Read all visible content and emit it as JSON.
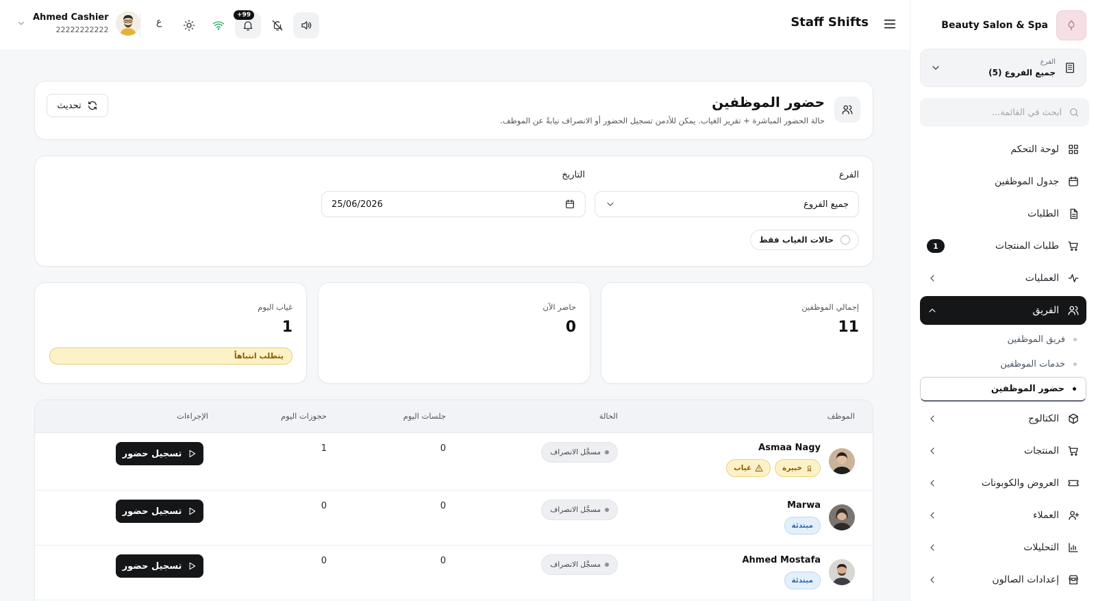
{
  "brand": {
    "name": "Beauty Salon & Spa",
    "logo_icon": "salon-logo"
  },
  "sidebar": {
    "branch": {
      "label": "الفرع",
      "value": "جميع الفروع (5)"
    },
    "search_placeholder": "ابحث في القائمة...",
    "items": [
      {
        "label": "لوحة التحكم",
        "icon": "grid-icon"
      },
      {
        "label": "جدول الموظفين",
        "icon": "calendar-icon"
      },
      {
        "label": "الطلبات",
        "icon": "document-icon"
      },
      {
        "label": "طلبات المنتجات",
        "icon": "cart-icon",
        "badge": "1"
      },
      {
        "label": "العمليات",
        "icon": "activity-icon"
      },
      {
        "label": "الفريق",
        "icon": "users-icon"
      },
      {
        "label": "الكتالوج",
        "icon": "box-icon"
      },
      {
        "label": "المنتجات",
        "icon": "cart-icon"
      },
      {
        "label": "العروض والكوبونات",
        "icon": "ticket-icon"
      },
      {
        "label": "العملاء",
        "icon": "user-plus-icon"
      },
      {
        "label": "التحليلات",
        "icon": "bar-chart-icon"
      },
      {
        "label": "إعدادات الصالون",
        "icon": "store-icon"
      }
    ],
    "team_sub": [
      {
        "label": "فريق الموظفين"
      },
      {
        "label": "خدمات الموظفين"
      },
      {
        "label": "حضور الموظفين"
      }
    ]
  },
  "header": {
    "title": "Staff Shifts",
    "notif_badge": "+99",
    "lang": "ع",
    "user": {
      "name": "Ahmed Cashier",
      "phone": "22222222222"
    }
  },
  "page": {
    "title": "حضور الموظفين",
    "subtitle": "حالة الحضور المباشرة + تقرير الغياب. يمكن للأدمن تسجيل الحضور أو الانصراف نيابةً عن الموظف.",
    "refresh_label": "تحديث"
  },
  "filters": {
    "branch_label": "الفرع",
    "branch_value": "جميع الفروع",
    "date_label": "التاريخ",
    "date_value": "25/06/2026",
    "absent_only_label": "حالات الغياب فقط"
  },
  "stats": {
    "total": {
      "label": "إجمالي الموظفين",
      "value": "11"
    },
    "present": {
      "label": "حاضر الآن",
      "value": "0"
    },
    "absent": {
      "label": "غياب اليوم",
      "value": "1",
      "alert": "يتطلب انتباهاً"
    }
  },
  "table": {
    "headers": {
      "employee": "الموظف",
      "status": "الحالة",
      "sessions": "جلسات اليوم",
      "bookings": "حجوزات اليوم",
      "actions": "الإجراءات"
    },
    "rows": [
      {
        "name": "Asmaa Nagy",
        "tags": [
          "خبيرة",
          "غياب"
        ],
        "status": "مسجَّل الانصراف",
        "sessions": "0",
        "bookings": "1",
        "action": "تسجيل حضور"
      },
      {
        "name": "Marwa",
        "tags": [
          "مبتدئة"
        ],
        "status": "مسجَّل الانصراف",
        "sessions": "0",
        "bookings": "0",
        "action": "تسجيل حضور"
      },
      {
        "name": "Ahmed Mostafa",
        "tags": [
          "مبتدئة"
        ],
        "status": "مسجَّل الانصراف",
        "sessions": "0",
        "bookings": "0",
        "action": "تسجيل حضور"
      }
    ]
  },
  "colors": {
    "accent_dark": "#151618",
    "warning_bg": "#fdf1c7",
    "info_bg": "#e3f0fb"
  }
}
